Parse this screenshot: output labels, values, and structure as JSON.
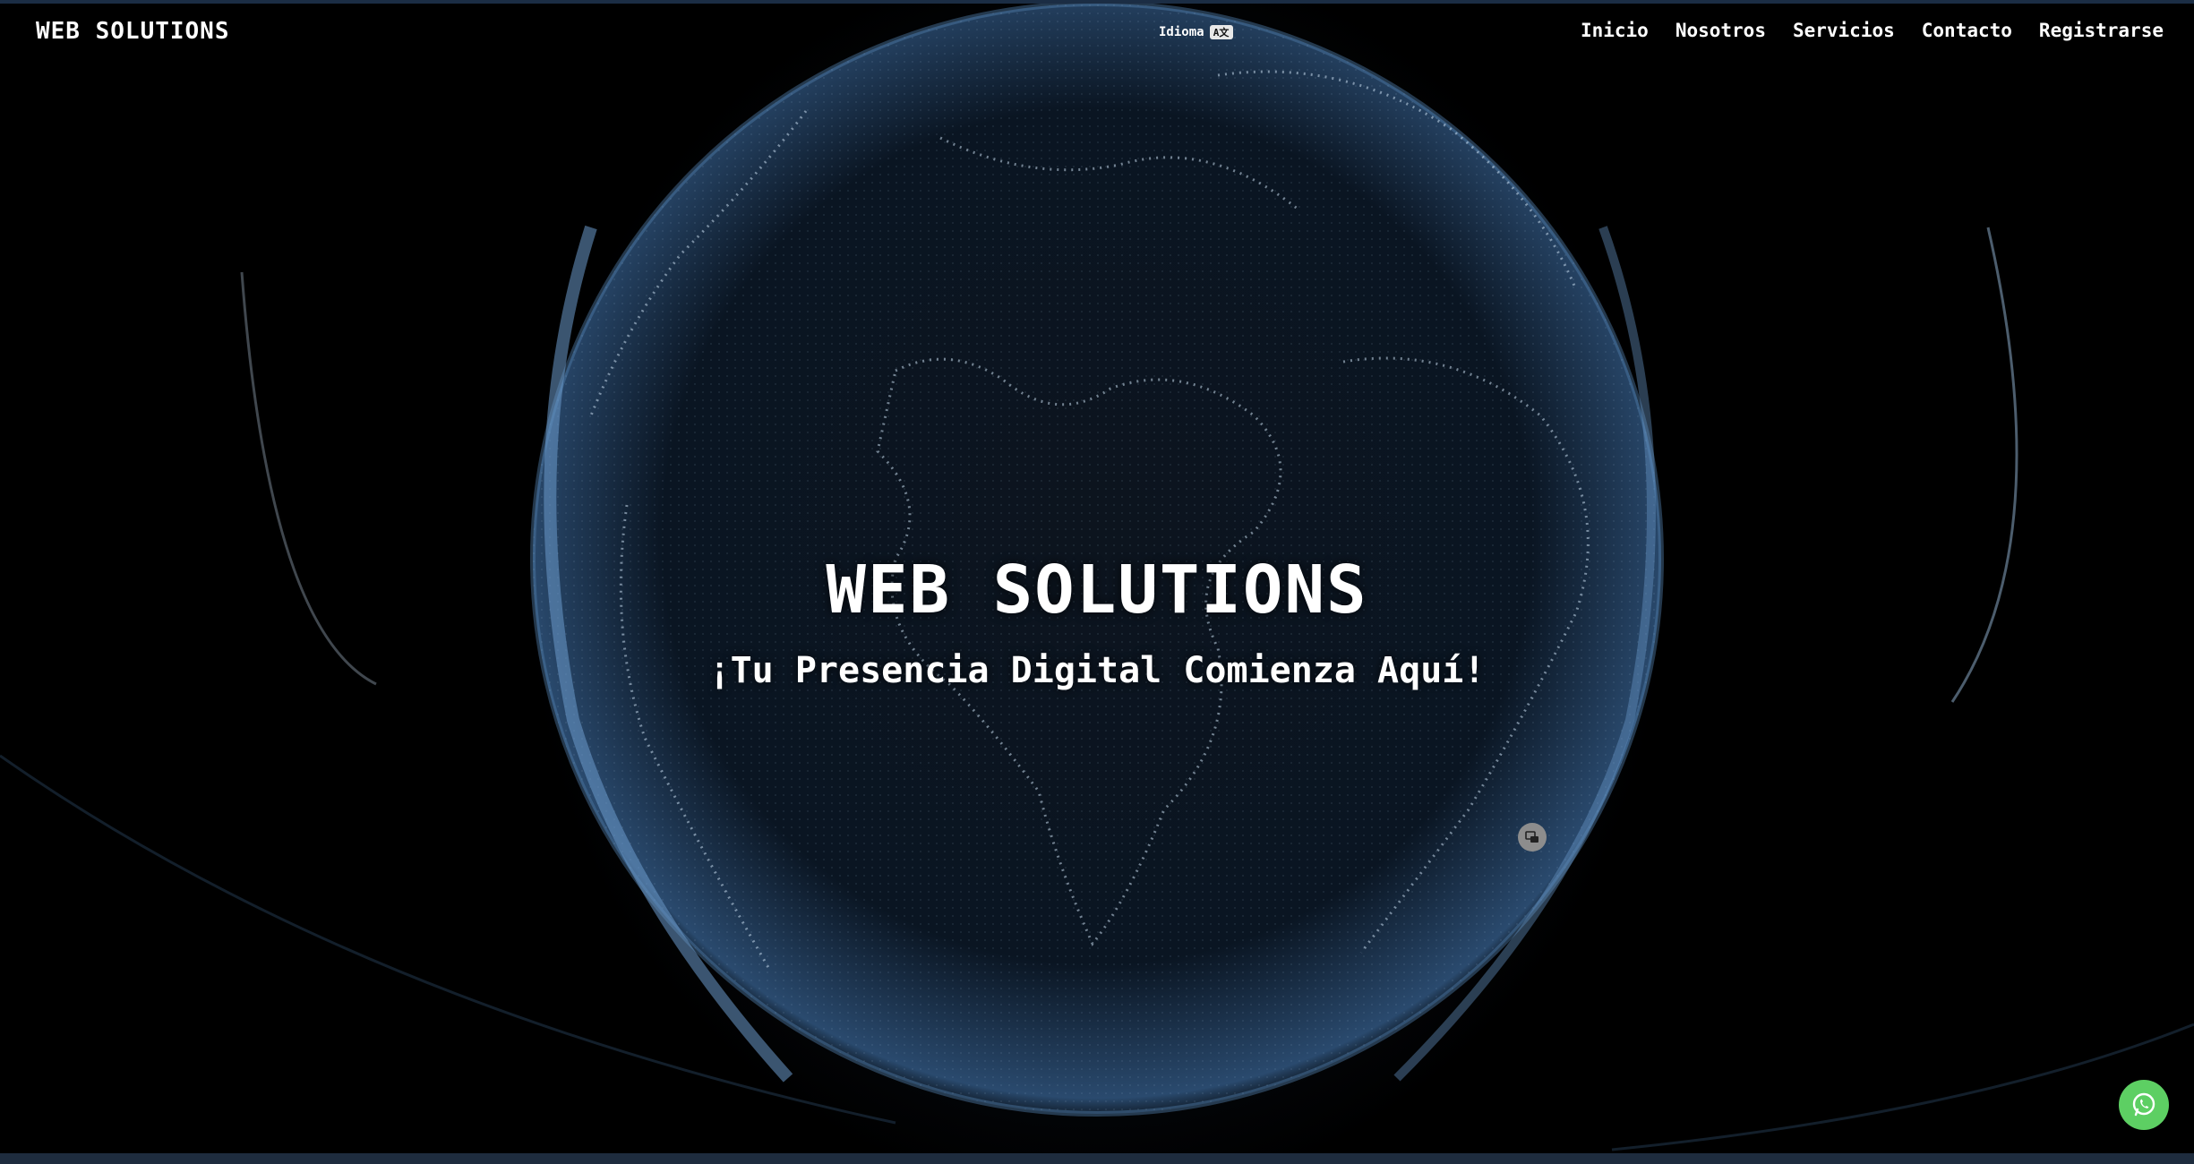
{
  "header": {
    "brand": "WEB SOLUTIONS",
    "language_label": "Idioma",
    "language_icon": "translate-icon",
    "nav": [
      {
        "label": "Inicio"
      },
      {
        "label": "Nosotros"
      },
      {
        "label": "Servicios"
      },
      {
        "label": "Contacto"
      },
      {
        "label": "Registrarse"
      }
    ]
  },
  "hero": {
    "title": "WEB SOLUTIONS",
    "subtitle": "¡Tu Presencia Digital Comienza Aquí!",
    "background": "globe-dots-image"
  },
  "floating": {
    "control_icon": "overlay-control-icon",
    "whatsapp_icon": "whatsapp-icon",
    "whatsapp_color": "#5dcf63"
  },
  "colors": {
    "background": "#000000",
    "globe_highlight": "#9fc3e8",
    "text": "#ffffff"
  }
}
